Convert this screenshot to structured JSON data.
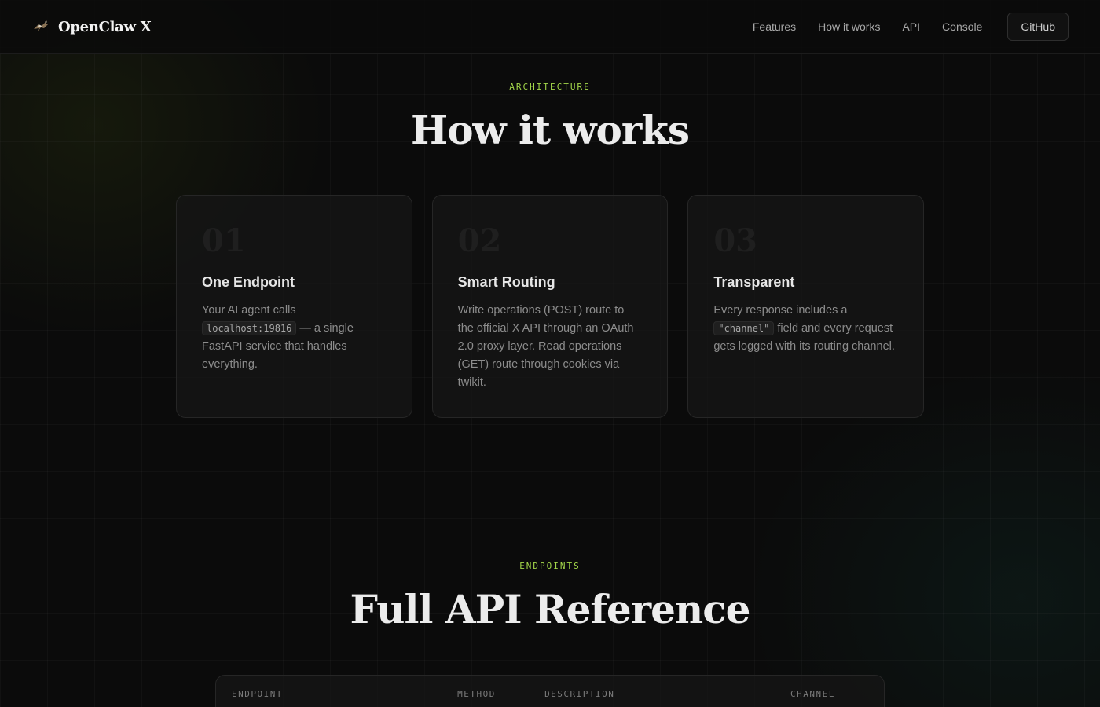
{
  "nav": {
    "brand": "OpenClaw X",
    "links": [
      "Features",
      "How it works",
      "API",
      "Console"
    ],
    "github_label": "GitHub"
  },
  "architecture": {
    "eyebrow": "ARCHITECTURE",
    "title": "How it works",
    "cards": [
      {
        "num": "01",
        "title": "One Endpoint",
        "desc_pre": "Your AI agent calls",
        "code": "localhost:19816",
        "desc_post": "— a single FastAPI service that handles everything."
      },
      {
        "num": "02",
        "title": "Smart Routing",
        "desc": "Write operations (POST) route to the official X API through an OAuth 2.0 proxy layer. Read operations (GET) route through cookies via twikit."
      },
      {
        "num": "03",
        "title": "Transparent",
        "desc_pre": "Every response includes a",
        "code": "\"channel\"",
        "desc_post": "field and every request gets logged with its routing channel."
      }
    ]
  },
  "endpoints": {
    "eyebrow": "ENDPOINTS",
    "title": "Full API Reference",
    "columns": [
      "ENDPOINT",
      "METHOD",
      "DESCRIPTION",
      "CHANNEL"
    ]
  },
  "colors": {
    "accent": "#a3d64a",
    "background": "#0b0b0b",
    "card_bg": "#161616"
  }
}
